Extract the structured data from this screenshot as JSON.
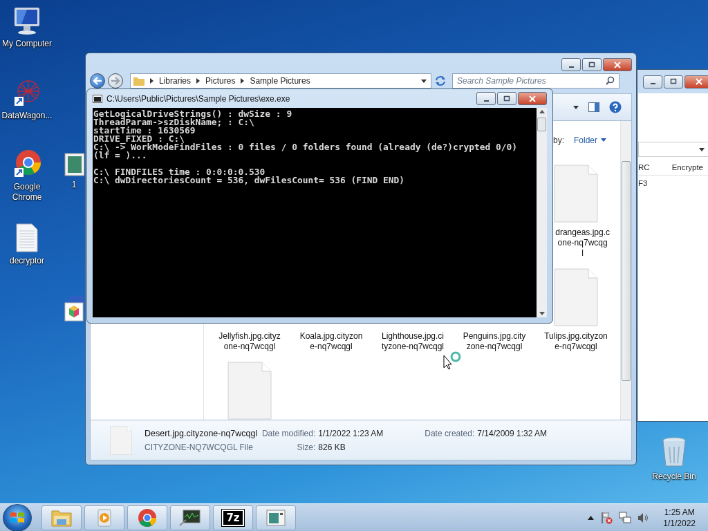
{
  "desktop_icons": [
    {
      "kind": "computer",
      "label": "My Computer"
    },
    {
      "kind": "network-app",
      "label": "DataWagon..."
    },
    {
      "kind": "chrome",
      "label": "Google Chrome"
    },
    {
      "kind": "document",
      "label": "decryptor"
    },
    {
      "kind": "picture",
      "label": "1"
    },
    {
      "kind": "cube"
    },
    {
      "kind": "recycle",
      "label": "Recycle Bin"
    }
  ],
  "explorer": {
    "breadcrumb": [
      "Libraries",
      "Pictures",
      "Sample Pictures"
    ],
    "search": {
      "placeholder": "Search Sample Pictures"
    },
    "arrange_by": {
      "label": "by:",
      "value": "Folder"
    },
    "file_rows": [
      [
        null,
        null,
        null,
        null,
        {
          "icon": true,
          "cut_left": true,
          "label": "drangeas.jpg.c\none-nq7wcqg\nl"
        }
      ],
      [
        {
          "icon": false,
          "cut_left": false,
          "label": "Jellyfish.jpg.cityz\none-nq7wcqgl"
        },
        {
          "icon": false,
          "cut_left": false,
          "label": "Koala.jpg.cityzon\ne-nq7wcqgl"
        },
        {
          "icon": false,
          "cut_left": false,
          "label": "Lighthouse.jpg.ci\ntyzone-nq7wcqgl"
        },
        {
          "icon": false,
          "cut_left": false,
          "label": "Penguins.jpg.city\nzone-nq7wcqgl"
        },
        {
          "icon": true,
          "cut_left": false,
          "label": "Tulips.jpg.cityzon\ne-nq7wcqgl"
        }
      ],
      [
        {
          "icon": true
        }
      ]
    ],
    "details": {
      "name": "Desert.jpg.cityzone-nq7wcqgl",
      "type": "CITYZONE-NQ7WCQGL File",
      "modified_label": "Date modified:",
      "modified": "1/1/2022 1:23 AM",
      "created_label": "Date created:",
      "created": "7/14/2009 1:32 AM",
      "size_label": "Size:",
      "size": "826 KB"
    }
  },
  "console": {
    "title": "C:\\Users\\Public\\Pictures\\Sample Pictures\\exe.exe",
    "output": "GetLogicalDriveStrings() : dwSize : 9\nThreadParam->szDiskName; : C:\\\nstartTime : 1630569\nDRIVE_FIXED : C:\\\nC:\\ -> WorkModeFindFiles : 0 files / 0 folders found (already (de?)crypted 0/0)\n(lf = )...\n\nC:\\ FINDFILES time : 0:0:0:0.530\nC:\\ dwDirectoriesCount = 536, dwFilesCount= 536 (FIND END)"
  },
  "background_window": {
    "columns": [
      "RC",
      "Encrypte"
    ],
    "cell": "F3"
  },
  "taskbar": {
    "items": [
      {
        "kind": "folder"
      },
      {
        "kind": "media"
      },
      {
        "kind": "chrome"
      },
      {
        "kind": "monitor"
      },
      {
        "kind": "text",
        "label": "7z"
      },
      {
        "kind": "window"
      }
    ],
    "clock": {
      "time": "1:25 AM",
      "date": "1/1/2022"
    }
  }
}
